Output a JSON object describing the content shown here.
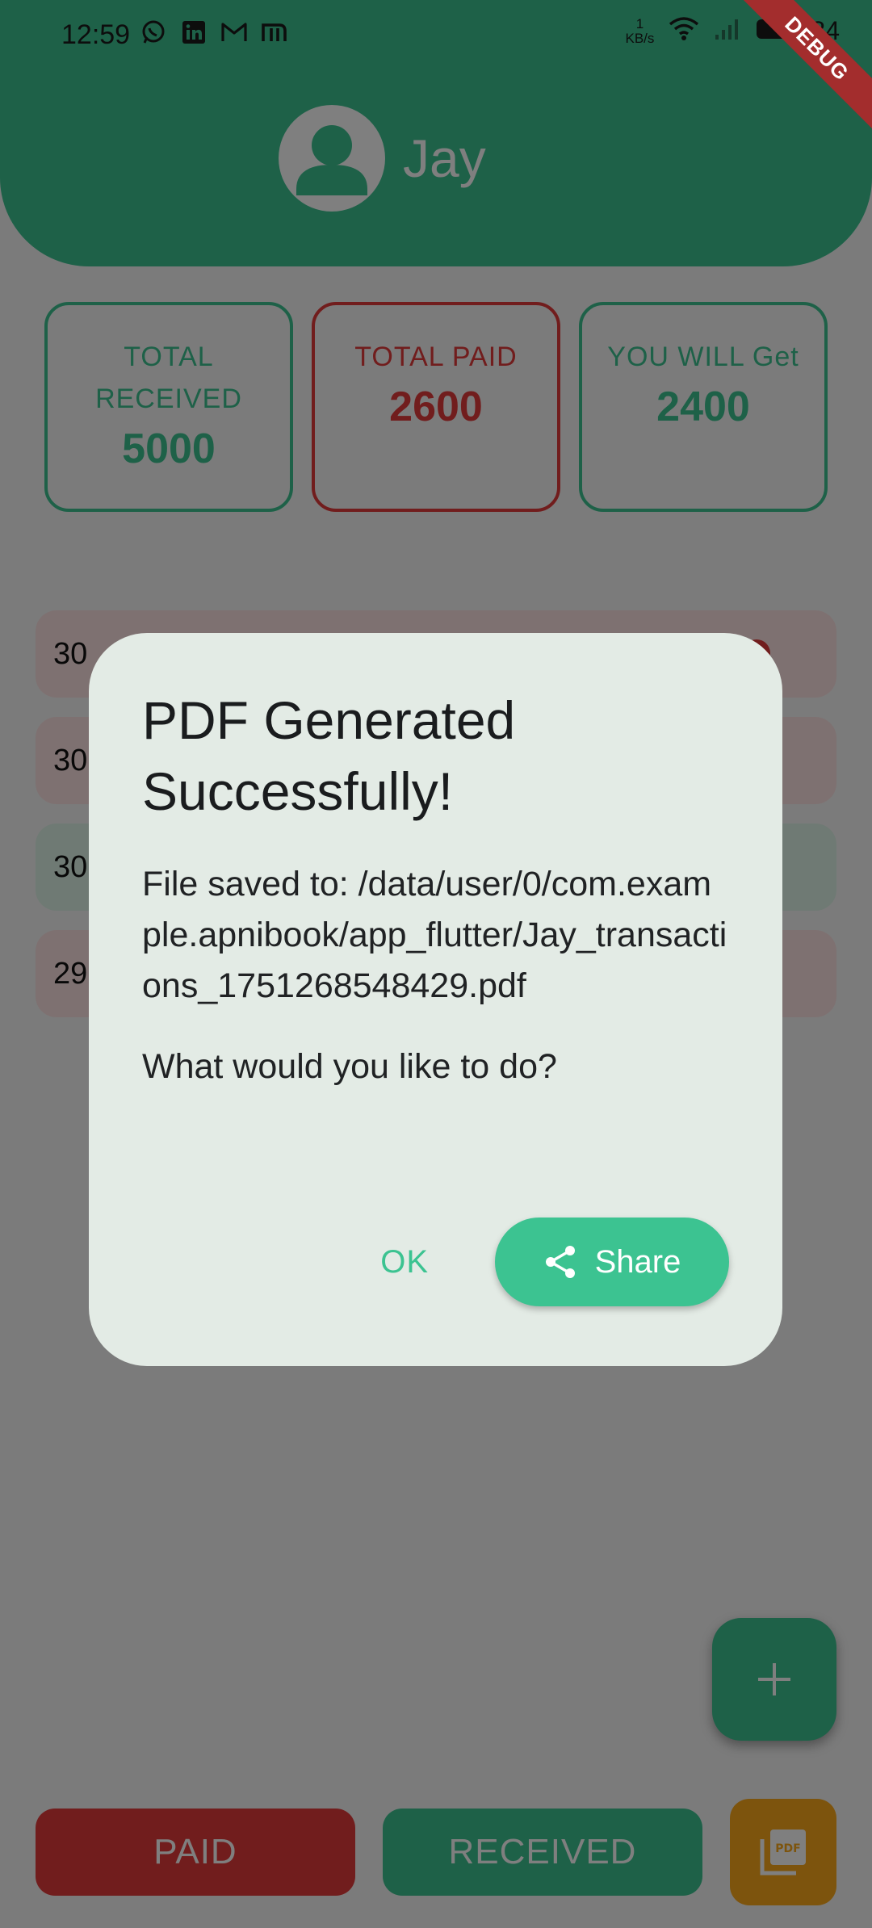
{
  "status_bar": {
    "time": "12:59",
    "net_speed_value": "1",
    "net_speed_unit": "KB/s",
    "battery": "84"
  },
  "debug_label": "DEBUG",
  "profile": {
    "name": "Jay"
  },
  "summary": {
    "received_label": "TOTAL RECEIVED",
    "received_value": "5000",
    "paid_label": "TOTAL PAID",
    "paid_value": "2600",
    "balance_label": "YOU WILL Get",
    "balance_value": "2400"
  },
  "transactions": [
    {
      "date": "30",
      "type": "paid"
    },
    {
      "date": "30",
      "type": "paid"
    },
    {
      "date": "30",
      "type": "received"
    },
    {
      "date": "29",
      "type": "paid"
    }
  ],
  "dialog": {
    "title": "PDF Generated Successfully!",
    "message": "File saved to: /data/user/0/com.example.apnibook/app_flutter/Jay_transactions_1751268548429.pdf",
    "question": "What would you like to do?",
    "ok_label": "OK",
    "share_label": "Share"
  },
  "actions": {
    "paid_label": "PAID",
    "received_label": "RECEIVED",
    "pdf_icon_text": "PDF"
  },
  "colors": {
    "green": "#3cc391",
    "red": "#e33a3a",
    "orange": "#fba91b"
  }
}
